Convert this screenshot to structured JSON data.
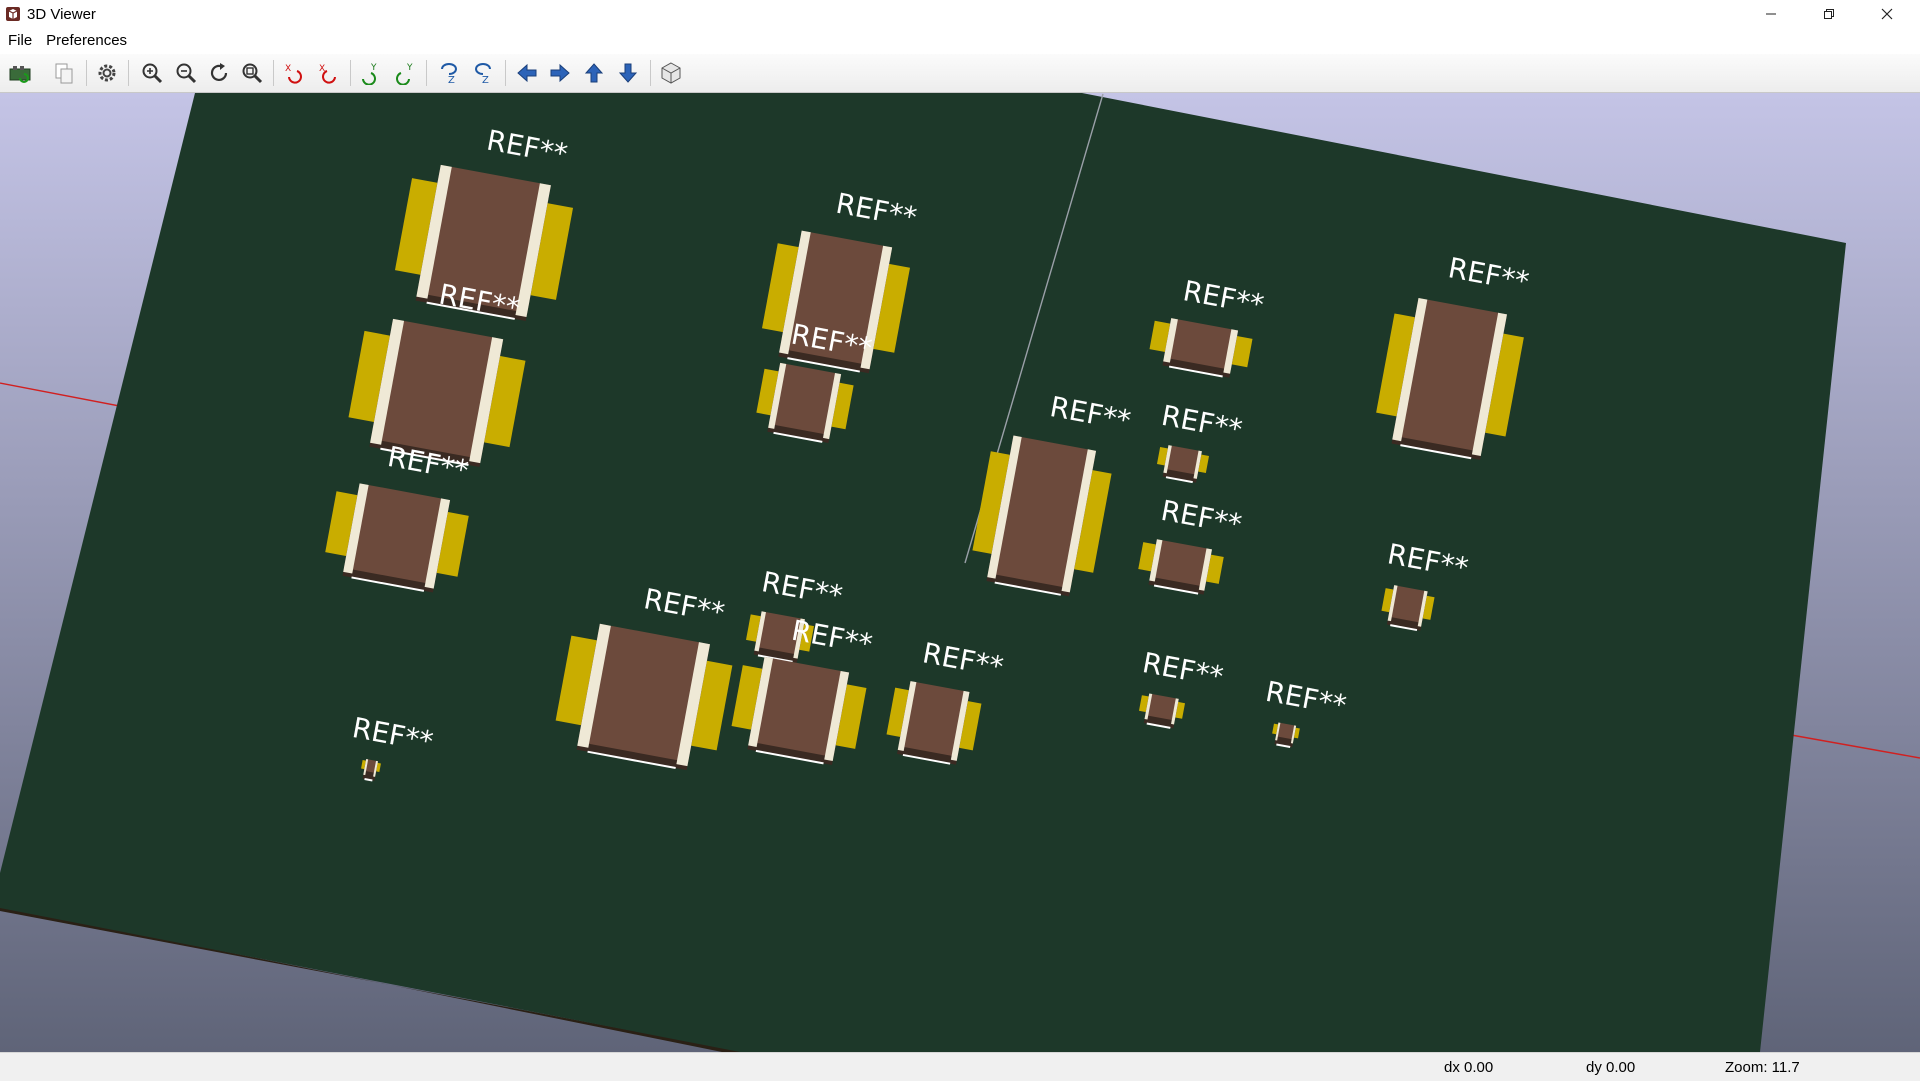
{
  "window": {
    "title": "3D Viewer"
  },
  "menu": {
    "items": [
      "File",
      "Preferences"
    ]
  },
  "toolbar": {
    "buttons": [
      "reload-board",
      "copy-to-clipboard",
      "options",
      "zoom-in",
      "zoom-out",
      "redraw",
      "zoom-fit",
      "rotate-x-cw",
      "rotate-x-ccw",
      "rotate-y-cw",
      "rotate-y-ccw",
      "rotate-z-cw",
      "rotate-z-ccw",
      "pan-left",
      "pan-right",
      "pan-up",
      "pan-down",
      "orthographic-toggle"
    ]
  },
  "viewport": {
    "board_color": "#1d3829",
    "pad_color": "#c9ad00",
    "body_color": "#6c4a3c",
    "terminal_color": "#efe9d6",
    "silk_color": "#ffffff",
    "components": [
      {
        "label": "REF**"
      },
      {
        "label": "REF**"
      },
      {
        "label": "REF**"
      },
      {
        "label": "REF**"
      },
      {
        "label": "REF**"
      },
      {
        "label": "REF**"
      },
      {
        "label": "REF**"
      },
      {
        "label": "REF**"
      },
      {
        "label": "REF**"
      },
      {
        "label": "REF**"
      },
      {
        "label": "REF**"
      },
      {
        "label": "REF**"
      },
      {
        "label": "REF**"
      },
      {
        "label": "REF**"
      },
      {
        "label": "REF**"
      },
      {
        "label": "REF**"
      },
      {
        "label": "REF**"
      },
      {
        "label": "REF**"
      },
      {
        "label": "REF**"
      }
    ]
  },
  "status": {
    "dx": "dx 0.00",
    "dy": "dy 0.00",
    "zoom": "Zoom: 11.7"
  }
}
